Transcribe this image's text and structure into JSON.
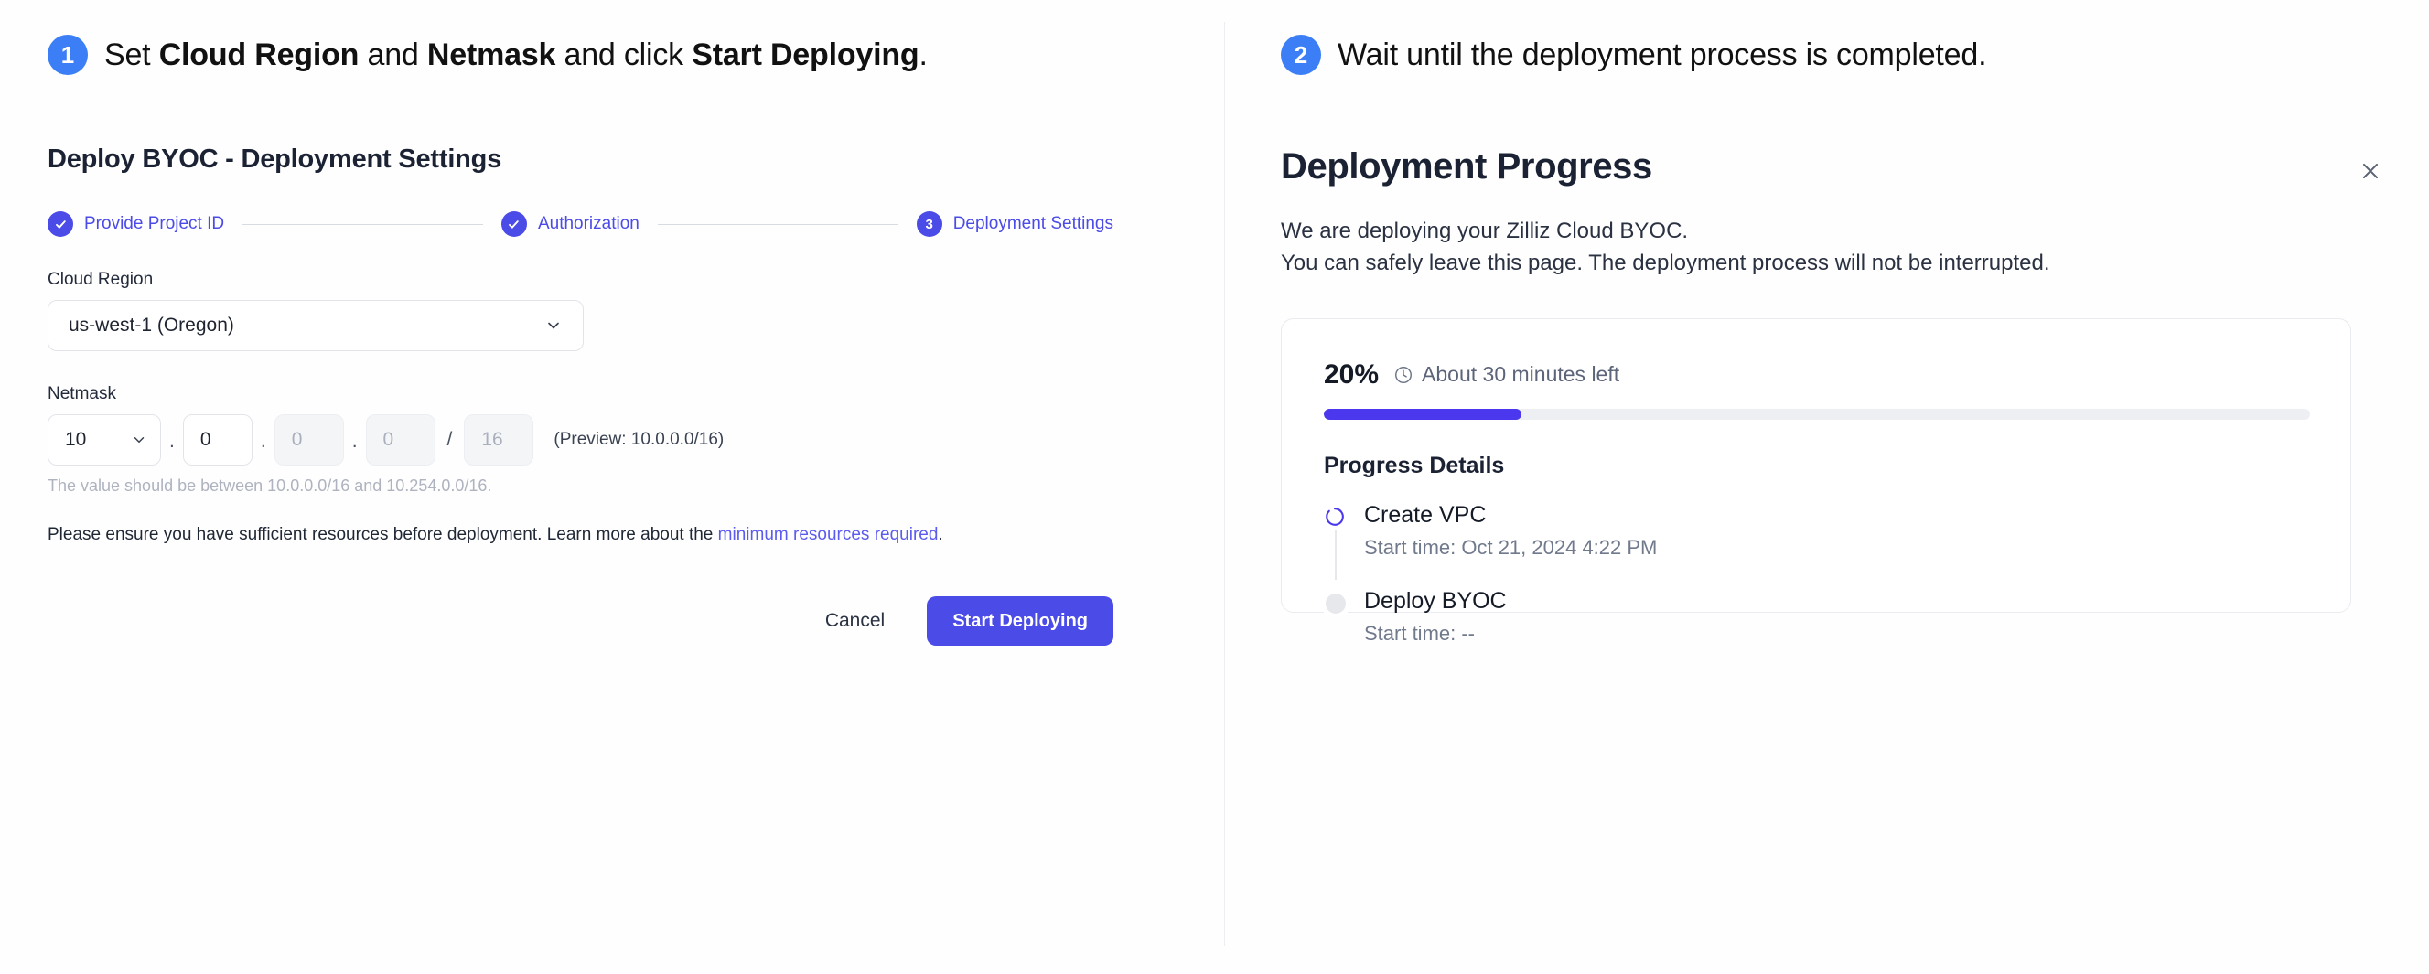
{
  "left": {
    "step_number": "1",
    "caption_parts": [
      {
        "text": "Set ",
        "bold": false
      },
      {
        "text": "Cloud Region",
        "bold": true
      },
      {
        "text": " and ",
        "bold": false
      },
      {
        "text": "Netmask",
        "bold": true
      },
      {
        "text": " and click ",
        "bold": false
      },
      {
        "text": "Start Deploying",
        "bold": true
      },
      {
        "text": ".",
        "bold": false
      }
    ],
    "caption_plain": "Set Cloud Region and Netmask and click Start Deploying.",
    "panel_title": "Deploy BYOC - Deployment Settings",
    "stepper": [
      {
        "state": "done",
        "marker": "check",
        "label": "Provide Project ID"
      },
      {
        "state": "done",
        "marker": "check",
        "label": "Authorization"
      },
      {
        "state": "current",
        "marker": "3",
        "label": "Deployment Settings"
      }
    ],
    "cloud_region": {
      "label": "Cloud Region",
      "value": "us-west-1 (Oregon)",
      "icon": "chevron-down-icon"
    },
    "netmask": {
      "label": "Netmask",
      "octet1": "10",
      "octet2": "0",
      "octet3": "0",
      "octet4": "0",
      "prefix": "16",
      "dot": ".",
      "slash": "/",
      "preview": "(Preview: 10.0.0.0/16)",
      "helper": "The value should be between 10.0.0.0/16 and 10.254.0.0/16."
    },
    "notice": {
      "before": "Please ensure you have sufficient resources before deployment. Learn more about the ",
      "link": "minimum resources required",
      "after": "."
    },
    "actions": {
      "cancel_label": "Cancel",
      "start_label": "Start Deploying"
    }
  },
  "right": {
    "step_number": "2",
    "caption_plain": "Wait until the deployment process is completed.",
    "dialog_title": "Deployment Progress",
    "close_icon": "close-icon",
    "description_line1": "We are deploying your Zilliz Cloud BYOC.",
    "description_line2": "You can safely leave this page. The deployment process will not be interrupted.",
    "progress": {
      "percent_label": "20%",
      "percent_value": 20,
      "eta_icon": "clock-icon",
      "eta_label": "About 30 minutes left"
    },
    "details_title": "Progress Details",
    "steps": [
      {
        "name": "Create VPC",
        "time": "Start time: Oct 21, 2024 4:22 PM",
        "icon": "spinner-icon",
        "state": "in-progress"
      },
      {
        "name": "Deploy BYOC",
        "time": "Start time: --",
        "icon": "pending-dot-icon",
        "state": "pending"
      }
    ]
  },
  "colors": {
    "badge_blue": "#3b7ef5",
    "brand_indigo": "#4b4be8",
    "progress_fill": "#4b38ee",
    "link": "#5b5bf0",
    "text_dark": "#1b2233",
    "muted": "#717a8d",
    "track": "#eeeff2"
  }
}
